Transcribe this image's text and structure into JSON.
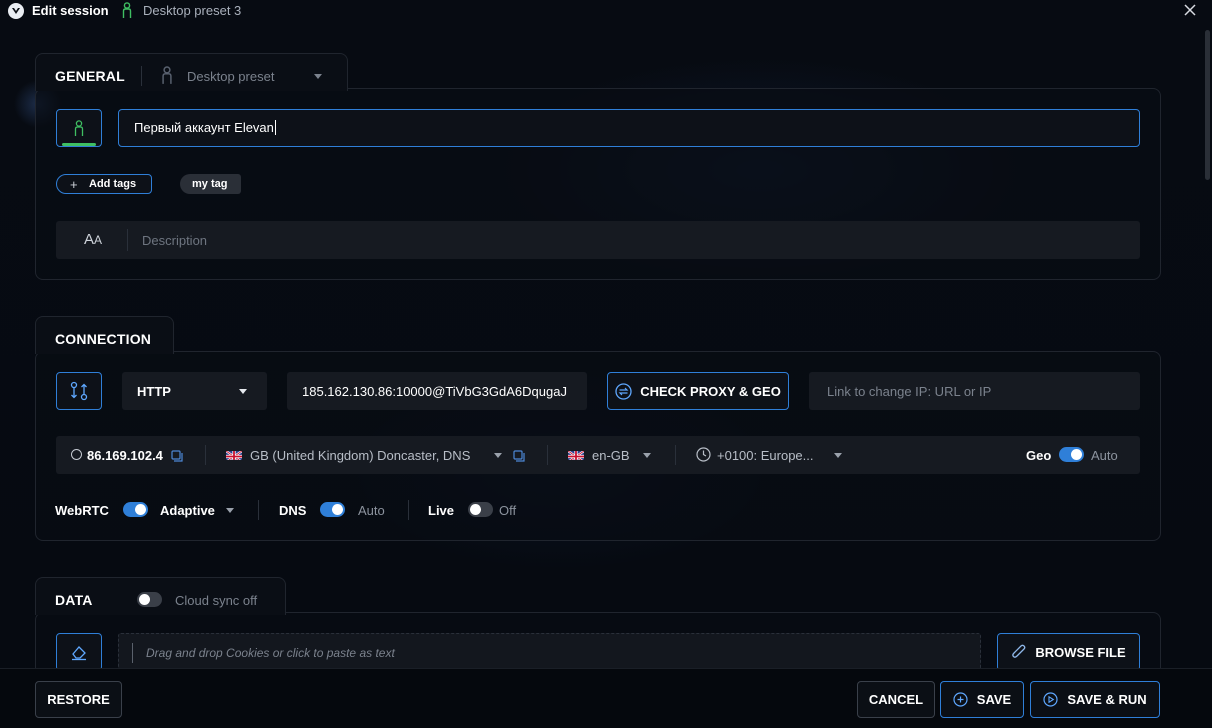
{
  "window": {
    "title": "Edit session",
    "preset_name": "Desktop preset 3",
    "close_icon": "close-icon"
  },
  "general": {
    "title": "GENERAL",
    "preset_select": "Desktop preset",
    "profile_name": "Первый аккаунт Elevan",
    "add_tags_label": "Add tags",
    "tags": [
      "my tag"
    ],
    "description_placeholder": "Description"
  },
  "connection": {
    "title": "CONNECTION",
    "proxy_type": "HTTP",
    "proxy_value": "185.162.130.86:10000@TiVbG3GdA6DqugaJ",
    "check_button": "CHECK PROXY & GEO",
    "change_ip_placeholder": "Link to change IP: URL or IP",
    "ip": "86.169.102.4",
    "geo_location": "GB (United Kingdom) Doncaster, DNS",
    "language": "en-GB",
    "timezone": "+0100: Europe...",
    "geo_label": "Geo",
    "geo_value": "Auto",
    "webrtc_label": "WebRTC",
    "webrtc_mode": "Adaptive",
    "dns_label": "DNS",
    "dns_value": "Auto",
    "live_label": "Live",
    "live_value": "Off"
  },
  "data_section": {
    "title": "DATA",
    "cloud_sync": "Cloud sync off",
    "cookies_placeholder": "Drag and drop Cookies or click to paste as text",
    "browse_button": "BROWSE FILE"
  },
  "footer": {
    "restore": "RESTORE",
    "cancel": "CANCEL",
    "save": "SAVE",
    "save_run": "SAVE & RUN"
  },
  "colors": {
    "accent": "#2f7fd8",
    "success_green": "#3fbf62",
    "background": "#070b12"
  }
}
